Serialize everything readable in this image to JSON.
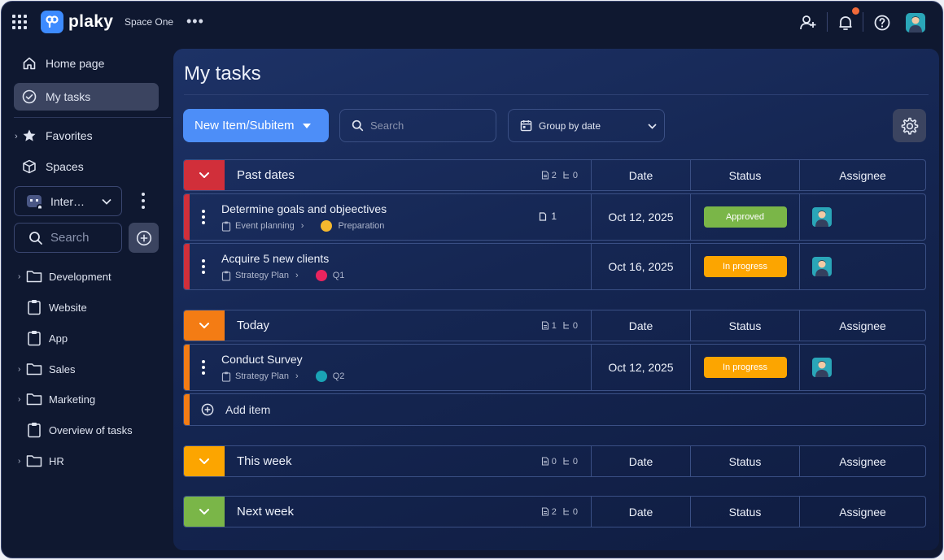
{
  "topbar": {
    "logo_text": "plaky",
    "space_name": "Space One",
    "more": "•••",
    "icons": [
      "apps-grid-icon",
      "add-user-icon",
      "bell-icon",
      "help-icon",
      "avatar"
    ]
  },
  "sidebar": {
    "home": "Home page",
    "my_tasks": "My tasks",
    "favorites": "Favorites",
    "spaces": "Spaces",
    "space_select": "Inter…",
    "search_placeholder": "Search",
    "tree": [
      {
        "label": "Development",
        "type": "folder"
      },
      {
        "label": "Website",
        "type": "board"
      },
      {
        "label": "App",
        "type": "board"
      },
      {
        "label": "Sales",
        "type": "folder"
      },
      {
        "label": "Marketing",
        "type": "folder"
      },
      {
        "label": "Overview of tasks",
        "type": "board"
      },
      {
        "label": "HR",
        "type": "folder"
      }
    ]
  },
  "main": {
    "title": "My tasks",
    "new_button": "New Item/Subitem",
    "search_placeholder": "Search",
    "group_by": "Group by date",
    "columns": {
      "date": "Date",
      "status": "Status",
      "assignee": "Assignee"
    },
    "add_item": "Add item"
  },
  "groups": [
    {
      "name": "Past dates",
      "color": "#d12f3a",
      "items_count": "2",
      "subitems_count": "0",
      "items": [
        {
          "title": "Determine goals and objeectives",
          "board": "Event planning",
          "group": "Preparation",
          "group_color": "#f5b82e",
          "subitems": "1",
          "date": "Oct 12, 2025",
          "status": "Approved",
          "status_color": "#7ab648"
        },
        {
          "title": "Acquire 5 new clients",
          "board": "Strategy Plan",
          "group": "Q1",
          "group_color": "#e8245e",
          "subitems": "",
          "date": "Oct 16, 2025",
          "status": "In progress",
          "status_color": "#fca500"
        }
      ]
    },
    {
      "name": "Today",
      "color": "#f47c14",
      "items_count": "1",
      "subitems_count": "0",
      "items": [
        {
          "title": "Conduct Survey",
          "board": "Strategy Plan",
          "group": "Q2",
          "group_color": "#1aa3b5",
          "subitems": "",
          "date": "Oct 12, 2025",
          "status": "In progress",
          "status_color": "#fca500"
        }
      ]
    },
    {
      "name": "This week",
      "color": "#fca500",
      "items_count": "0",
      "subitems_count": "0",
      "items": []
    },
    {
      "name": "Next week",
      "color": "#7ab648",
      "items_count": "2",
      "subitems_count": "0",
      "items": []
    }
  ]
}
